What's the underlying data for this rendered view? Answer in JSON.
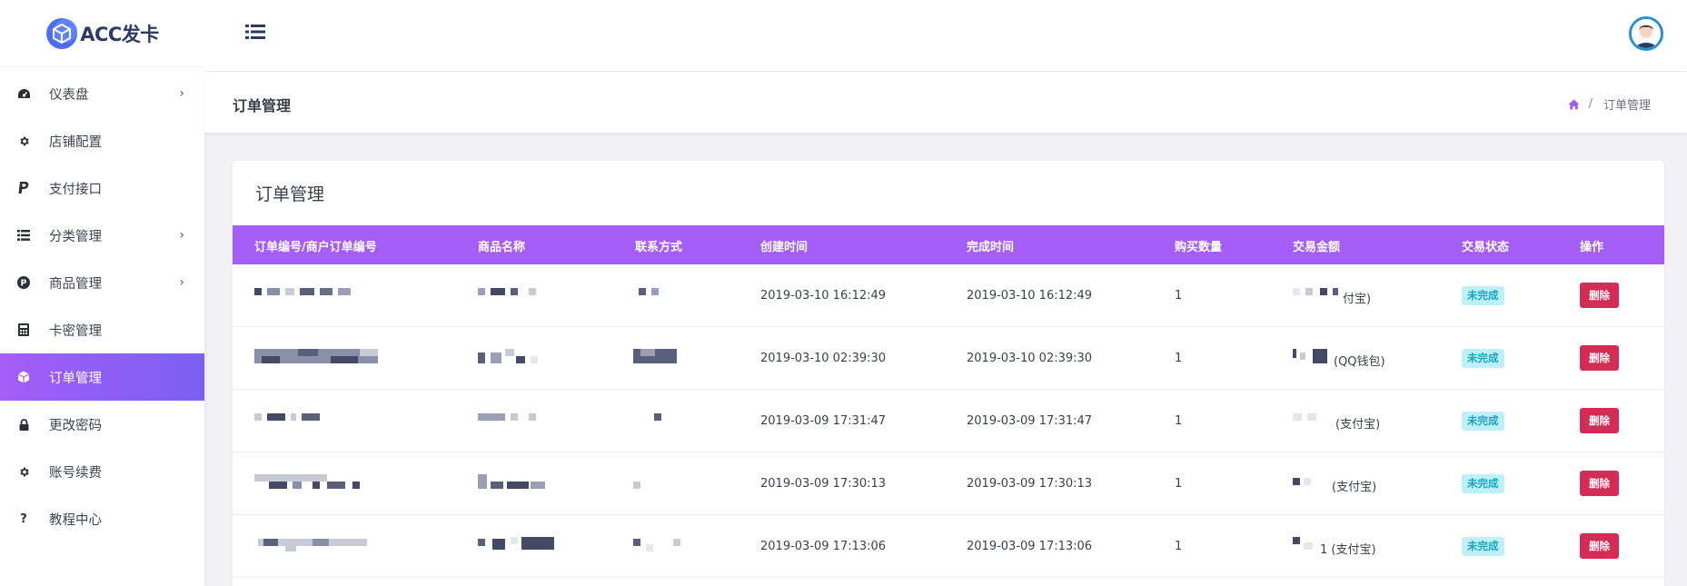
{
  "brand": {
    "name": "ACC发卡"
  },
  "sidebar": {
    "items": [
      {
        "label": "仪表盘",
        "icon": "dashboard-icon",
        "has_submenu": true,
        "active": false
      },
      {
        "label": "店铺配置",
        "icon": "gear-icon",
        "has_submenu": false,
        "active": false
      },
      {
        "label": "支付接口",
        "icon": "paypal-icon",
        "has_submenu": false,
        "active": false
      },
      {
        "label": "分类管理",
        "icon": "list-icon",
        "has_submenu": true,
        "active": false
      },
      {
        "label": "商品管理",
        "icon": "product-p-icon",
        "has_submenu": true,
        "active": false
      },
      {
        "label": "卡密管理",
        "icon": "calculator-icon",
        "has_submenu": false,
        "active": false
      },
      {
        "label": "订单管理",
        "icon": "cube-icon",
        "has_submenu": false,
        "active": true
      },
      {
        "label": "更改密码",
        "icon": "lock-icon",
        "has_submenu": false,
        "active": false
      },
      {
        "label": "账号续费",
        "icon": "gear-icon",
        "has_submenu": false,
        "active": false
      },
      {
        "label": "教程中心",
        "icon": "question-icon",
        "has_submenu": false,
        "active": false
      }
    ]
  },
  "page": {
    "title": "订单管理",
    "breadcrumb": {
      "separator": "/",
      "current": "订单管理"
    }
  },
  "card": {
    "title": "订单管理",
    "columns": [
      "订单编号/商户订单编号",
      "商品名称",
      "联系方式",
      "创建时间",
      "完成时间",
      "购买数量",
      "交易金额",
      "交易状态",
      "操作"
    ],
    "rows": [
      {
        "created": "2019-03-10 16:12:49",
        "completed": "2019-03-10 16:12:49",
        "qty": "1",
        "amount_suffix": "付宝)",
        "status": "未完成",
        "action": "删除"
      },
      {
        "created": "2019-03-10 02:39:30",
        "completed": "2019-03-10 02:39:30",
        "qty": "1",
        "amount_suffix": "(QQ钱包)",
        "status": "未完成",
        "action": "删除"
      },
      {
        "created": "2019-03-09 17:31:47",
        "completed": "2019-03-09 17:31:47",
        "qty": "1",
        "amount_suffix": "(支付宝)",
        "status": "未完成",
        "action": "删除"
      },
      {
        "created": "2019-03-09 17:30:13",
        "completed": "2019-03-09 17:30:13",
        "qty": "1",
        "amount_suffix": "(支付宝)",
        "status": "未完成",
        "action": "删除"
      },
      {
        "created": "2019-03-09 17:13:06",
        "completed": "2019-03-09 17:13:06",
        "qty": "1",
        "amount_suffix": "1 (支付宝)",
        "status": "未完成",
        "action": "删除"
      }
    ]
  },
  "colors": {
    "accent": "#a45ef7",
    "badge_bg": "#bdf0f8",
    "badge_text": "#17a7c2",
    "danger": "#d42d55"
  }
}
